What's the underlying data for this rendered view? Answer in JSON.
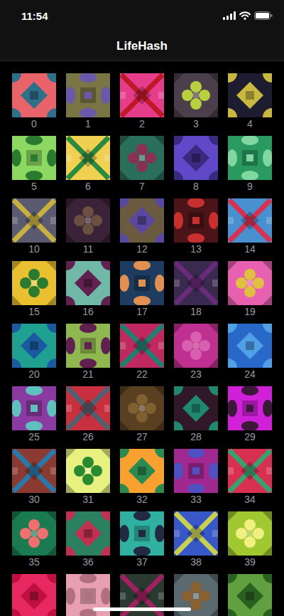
{
  "status_bar": {
    "time": "11:54"
  },
  "nav_bar": {
    "title": "LifeHash"
  },
  "tiles": [
    {
      "label": "0",
      "color": "#e8636a",
      "accent": "#2e6f8a"
    },
    {
      "label": "1",
      "color": "#7a7544",
      "accent": "#6a58a8"
    },
    {
      "label": "2",
      "color": "#e63c8c",
      "accent": "#c01828"
    },
    {
      "label": "3",
      "color": "#4a3f4a",
      "accent": "#b8d040"
    },
    {
      "label": "4",
      "color": "#1e1c30",
      "accent": "#c8b840"
    },
    {
      "label": "5",
      "color": "#8cd860",
      "accent": "#2a7a30"
    },
    {
      "label": "6",
      "color": "#f0d050",
      "accent": "#2a8a40"
    },
    {
      "label": "7",
      "color": "#2a6e5c",
      "accent": "#8a3050"
    },
    {
      "label": "8",
      "color": "#6048c8",
      "accent": "#3a2a80"
    },
    {
      "label": "9",
      "color": "#2a9a60",
      "accent": "#80d8a0"
    },
    {
      "label": "10",
      "color": "#5a5a70",
      "accent": "#c8b040"
    },
    {
      "label": "11",
      "color": "#3a2238",
      "accent": "#6a5040"
    },
    {
      "label": "12",
      "color": "#6a5a40",
      "accent": "#5a48a0"
    },
    {
      "label": "13",
      "color": "#4a1418",
      "accent": "#c83030"
    },
    {
      "label": "14",
      "color": "#4890d0",
      "accent": "#d83050"
    },
    {
      "label": "15",
      "color": "#e8c030",
      "accent": "#2a7a30"
    },
    {
      "label": "16",
      "color": "#70b8a8",
      "accent": "#602050"
    },
    {
      "label": "17",
      "color": "#1e3c60",
      "accent": "#e09050"
    },
    {
      "label": "18",
      "color": "#3a2a50",
      "accent": "#6a2a7a"
    },
    {
      "label": "19",
      "color": "#e860b0",
      "accent": "#e0c040"
    },
    {
      "label": "20",
      "color": "#20a090",
      "accent": "#1a5aa0"
    },
    {
      "label": "21",
      "color": "#90b850",
      "accent": "#602050"
    },
    {
      "label": "22",
      "color": "#c02860",
      "accent": "#208070"
    },
    {
      "label": "23",
      "color": "#c03090",
      "accent": "#d860b0"
    },
    {
      "label": "24",
      "color": "#2868c8",
      "accent": "#50a0e8"
    },
    {
      "label": "25",
      "color": "#8a3aa0",
      "accent": "#60c0c0"
    },
    {
      "label": "26",
      "color": "#c83040",
      "accent": "#506070"
    },
    {
      "label": "27",
      "color": "#5a4020",
      "accent": "#806030"
    },
    {
      "label": "28",
      "color": "#301828",
      "accent": "#208870"
    },
    {
      "label": "29",
      "color": "#d020d8",
      "accent": "#3a1a38"
    },
    {
      "label": "30",
      "color": "#8a3a30",
      "accent": "#2a78a8"
    },
    {
      "label": "31",
      "color": "#e8f080",
      "accent": "#2a8a30"
    },
    {
      "label": "32",
      "color": "#f8a030",
      "accent": "#2a8a50"
    },
    {
      "label": "33",
      "color": "#a02890",
      "accent": "#5050c0"
    },
    {
      "label": "34",
      "color": "#d83050",
      "accent": "#3aa070"
    },
    {
      "label": "35",
      "color": "#1a7a50",
      "accent": "#f07070"
    },
    {
      "label": "36",
      "color": "#2a8060",
      "accent": "#c03050"
    },
    {
      "label": "37",
      "color": "#30b0a0",
      "accent": "#202a40"
    },
    {
      "label": "38",
      "color": "#3858c8",
      "accent": "#c8d050"
    },
    {
      "label": "39",
      "color": "#a0c830",
      "accent": "#f0f080"
    },
    {
      "color": "#e82860",
      "accent": "#c01040"
    },
    {
      "color": "#e8a0b0",
      "accent": "#b07080"
    },
    {
      "color": "#2a3a30",
      "accent": "#a02060"
    },
    {
      "color": "#5a6a70",
      "accent": "#8a6030"
    },
    {
      "color": "#60a040",
      "accent": "#2a6020"
    }
  ]
}
